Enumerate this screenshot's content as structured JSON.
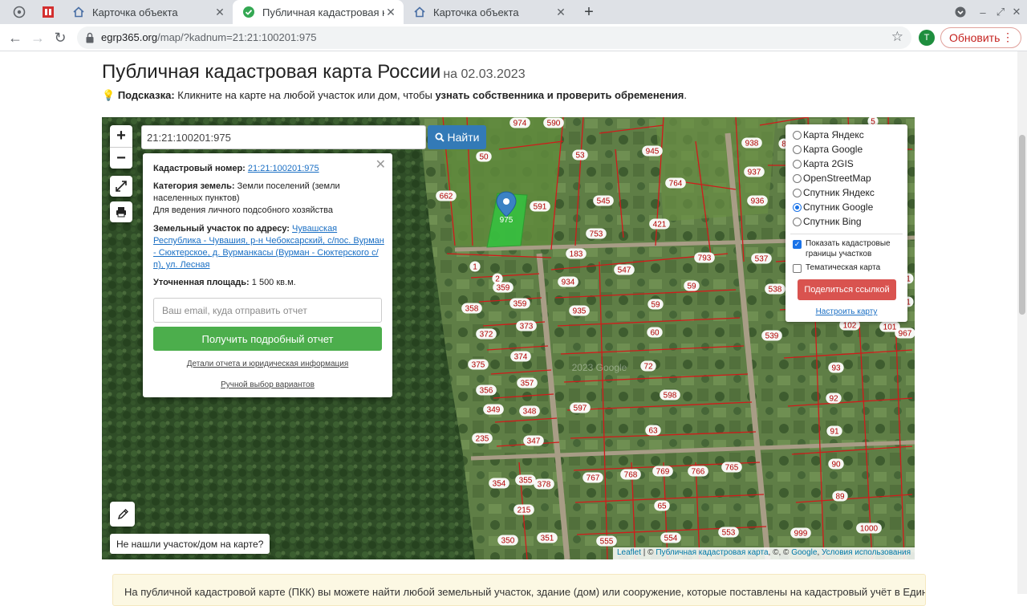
{
  "browser": {
    "tabs": [
      {
        "title": "Карточка объекта",
        "active": false
      },
      {
        "title": "Публичная кадастровая карт",
        "active": true
      },
      {
        "title": "Карточка объекта",
        "active": false
      }
    ],
    "url_host": "egrp365.org",
    "url_path": "/map/?kadnum=21:21:100201:975",
    "avatar_letter": "T",
    "update_label": "Обновить",
    "accent": "#1a73e8"
  },
  "page": {
    "title": "Публичная кадастровая карта России",
    "date": "на 02.03.2023",
    "hint_icon": "💡",
    "hint_label": "Подсказка:",
    "hint_text": " Кликните на карте на любой участок или дом, чтобы ",
    "hint_bold": "узнать собственника и проверить обременения",
    "hint_end": ".",
    "info_text": "На публичной кадастровой карте (ПКК) вы можете найти любой земельный участок, здание (дом) или сооружение, которые поставлены на кадастровый учёт в Единый"
  },
  "map": {
    "zoom_in": "+",
    "zoom_out": "−",
    "search_value": "21:21:100201:975",
    "find_label": "Найти",
    "marker_label": "975",
    "watermark": "2023 Google",
    "not_found": "Не нашли участок/дом на карте?",
    "attribution": {
      "leaflet": "Leaflet",
      "sep1": " | © ",
      "pkk": "Публичная кадастровая карта",
      "sep2": ", ©, © ",
      "google": "Google",
      "sep3": ", ",
      "terms": "Условия использования"
    },
    "parcel_labels": [
      "974",
      "590",
      "50",
      "53",
      "945",
      "938",
      "937",
      "936",
      "662",
      "591",
      "545",
      "764",
      "421",
      "753",
      "183",
      "1",
      "547",
      "793",
      "537",
      "2",
      "359",
      "934",
      "59",
      "538",
      "358",
      "359",
      "935",
      "59",
      "373",
      "372",
      "60",
      "539",
      "374",
      "375",
      "72",
      "93",
      "357",
      "356",
      "598",
      "92",
      "349",
      "348",
      "597",
      "235",
      "347",
      "63",
      "91",
      "354",
      "355",
      "378",
      "767",
      "768",
      "769",
      "766",
      "765",
      "90",
      "215",
      "65",
      "89",
      "350",
      "351",
      "555",
      "554",
      "553",
      "999",
      "1000",
      "102",
      "101",
      "967",
      "5",
      "1",
      "1",
      "8"
    ]
  },
  "popup": {
    "cadnum_label": "Кадастровый номер:",
    "cadnum_value": "21:21:100201:975",
    "category_label": "Категория земель:",
    "category_value": " Земли поселений (земли населенных пунктов)",
    "use": "Для ведения личного подсобного хозяйства",
    "address_label": "Земельный участок по адресу:",
    "address_value": "Чувашская Республика - Чувашия, р-н Чебоксарский, с/пос. Вурман - Сюктерское, д. Вурманкасы (Вурман - Сюктерского с/п), ул. Лесная",
    "area_label": "Уточненная площадь:",
    "area_value": " 1 500 кв.м.",
    "email_placeholder": "Ваш email, куда отправить отчет",
    "report_button": "Получить подробный отчет",
    "details_link": "Детали отчета и юридическая информация",
    "manual_link": "Ручной выбор вариантов"
  },
  "layers": {
    "options": [
      {
        "label": "Карта Яндекс",
        "selected": false
      },
      {
        "label": "Карта Google",
        "selected": false
      },
      {
        "label": "Карта 2GIS",
        "selected": false
      },
      {
        "label": "OpenStreetMap",
        "selected": false
      },
      {
        "label": "Спутник Яндекс",
        "selected": false
      },
      {
        "label": "Спутник Google",
        "selected": true
      },
      {
        "label": "Спутник Bing",
        "selected": false
      }
    ],
    "show_borders": "Показать кадастровые границы участков",
    "show_borders_checked": true,
    "thematic": "Тематическая карта",
    "thematic_checked": false,
    "share_button": "Поделиться ссылкой",
    "setup_link": "Настроить карту"
  }
}
